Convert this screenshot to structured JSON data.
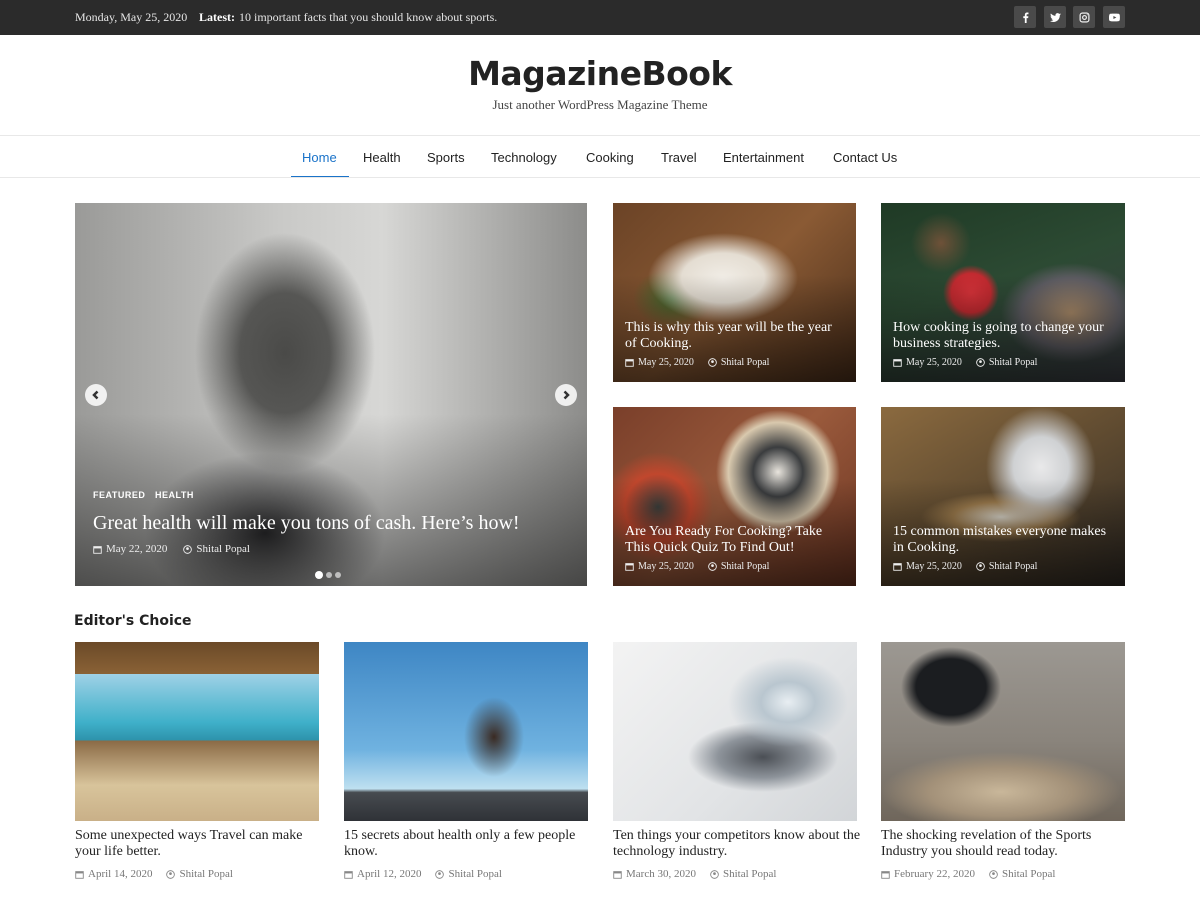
{
  "topbar": {
    "date": "Monday, May 25, 2020",
    "latest_label": "Latest:",
    "latest_text": "10 important facts that you should know about sports.",
    "social": [
      {
        "icon": "facebook-icon"
      },
      {
        "icon": "twitter-icon"
      },
      {
        "icon": "instagram-icon"
      },
      {
        "icon": "youtube-icon"
      }
    ]
  },
  "header": {
    "site_title": "MagazineBook",
    "tagline": "Just another WordPress Magazine Theme"
  },
  "nav": {
    "items": [
      "Home",
      "Health",
      "Sports",
      "Technology",
      "Cooking",
      "Travel",
      "Entertainment",
      "Contact Us"
    ],
    "active": "Home",
    "accent_color": "#1a73c9"
  },
  "hero": {
    "categories": [
      "FEATURED",
      "HEALTH"
    ],
    "title": "Great health will make you tons of cash. Here’s how!",
    "date": "May 22, 2020",
    "author": "Shital Popal",
    "slide_count": 3,
    "active_slide": 1
  },
  "featured_grid": [
    {
      "title": "This is why this year will be the year of Cooking.",
      "date": "May 25, 2020",
      "author": "Shital Popal"
    },
    {
      "title": "How cooking is going to change your business strategies.",
      "date": "May 25, 2020",
      "author": "Shital Popal"
    },
    {
      "title": "Are You Ready For Cooking? Take This Quick Quiz To Find Out!",
      "date": "May 25, 2020",
      "author": "Shital Popal"
    },
    {
      "title": "15 common mistakes everyone makes in Cooking.",
      "date": "May 25, 2020",
      "author": "Shital Popal"
    }
  ],
  "editors_choice": {
    "heading": "Editor's Choice",
    "cards": [
      {
        "title": "Some unexpected ways Travel can make your life better.",
        "date": "April 14, 2020",
        "author": "Shital Popal"
      },
      {
        "title": "15 secrets about health only a few people know.",
        "date": "April 12, 2020",
        "author": "Shital Popal"
      },
      {
        "title": "Ten things your competitors know about the technology industry.",
        "date": "March 30, 2020",
        "author": "Shital Popal"
      },
      {
        "title": "The shocking revelation of the Sports Industry you should read today.",
        "date": "February 22, 2020",
        "author": "Shital Popal"
      }
    ]
  }
}
